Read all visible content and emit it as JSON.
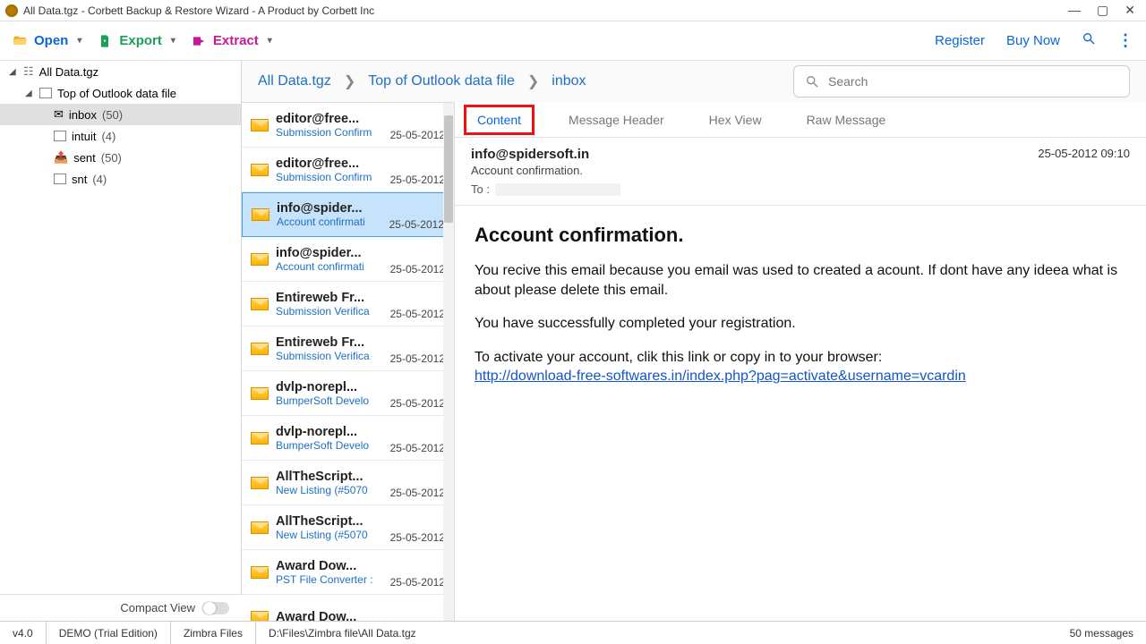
{
  "window": {
    "title": "All Data.tgz - Corbett Backup & Restore Wizard - A Product by Corbett Inc"
  },
  "toolbar": {
    "open": "Open",
    "export": "Export",
    "extract": "Extract",
    "register": "Register",
    "buy_now": "Buy Now"
  },
  "tree": {
    "root": {
      "label": "All Data.tgz"
    },
    "top": {
      "label": "Top of Outlook data file"
    },
    "items": [
      {
        "label": "inbox",
        "count": "(50)"
      },
      {
        "label": "intuit",
        "count": "(4)"
      },
      {
        "label": "sent",
        "count": "(50)"
      },
      {
        "label": "snt",
        "count": "(4)"
      }
    ]
  },
  "breadcrumb": [
    "All Data.tgz",
    "Top of Outlook data file",
    "inbox"
  ],
  "search_placeholder": "Search",
  "messages": [
    {
      "from": "editor@free...",
      "subj": "Submission Confirm",
      "date": "25-05-2012"
    },
    {
      "from": "editor@free...",
      "subj": "Submission Confirm",
      "date": "25-05-2012"
    },
    {
      "from": "info@spider...",
      "subj": "Account confirmati",
      "date": "25-05-2012",
      "selected": true
    },
    {
      "from": "info@spider...",
      "subj": "Account confirmati",
      "date": "25-05-2012"
    },
    {
      "from": "Entireweb Fr...",
      "subj": "Submission Verifica",
      "date": "25-05-2012"
    },
    {
      "from": "Entireweb Fr...",
      "subj": "Submission Verifica",
      "date": "25-05-2012"
    },
    {
      "from": "dvlp-norepl...",
      "subj": "BumperSoft Develo",
      "date": "25-05-2012"
    },
    {
      "from": "dvlp-norepl...",
      "subj": "BumperSoft Develo",
      "date": "25-05-2012"
    },
    {
      "from": "AllTheScript...",
      "subj": "New Listing (#5070",
      "date": "25-05-2012"
    },
    {
      "from": "AllTheScript...",
      "subj": "New Listing (#5070",
      "date": "25-05-2012"
    },
    {
      "from": "Award Dow...",
      "subj": "PST File Converter :",
      "date": "25-05-2012"
    },
    {
      "from": "Award Dow...",
      "subj": "",
      "date": ""
    }
  ],
  "tabs": [
    "Content",
    "Message Header",
    "Hex View",
    "Raw Message"
  ],
  "preview": {
    "from": "info@spidersoft.in",
    "subject": "Account confirmation.",
    "to_label": "To :",
    "datetime": "25-05-2012 09:10",
    "body_title": "Account confirmation.",
    "body_p1": "You recive this email because you email was used to created a acount. If dont have any ideea what is about please delete this email.",
    "body_p2": "You have successfully completed your registration.",
    "body_p3": "To activate your account, clik this link or copy in to your browser:",
    "body_link": "http://download-free-softwares.in/index.php?pag=activate&username=vcardin"
  },
  "compact_label": "Compact View",
  "status": {
    "version": "v4.0",
    "edition": "DEMO (Trial Edition)",
    "mode": "Zimbra Files",
    "path": "D:\\Files\\Zimbra file\\All Data.tgz",
    "count": "50  messages"
  }
}
